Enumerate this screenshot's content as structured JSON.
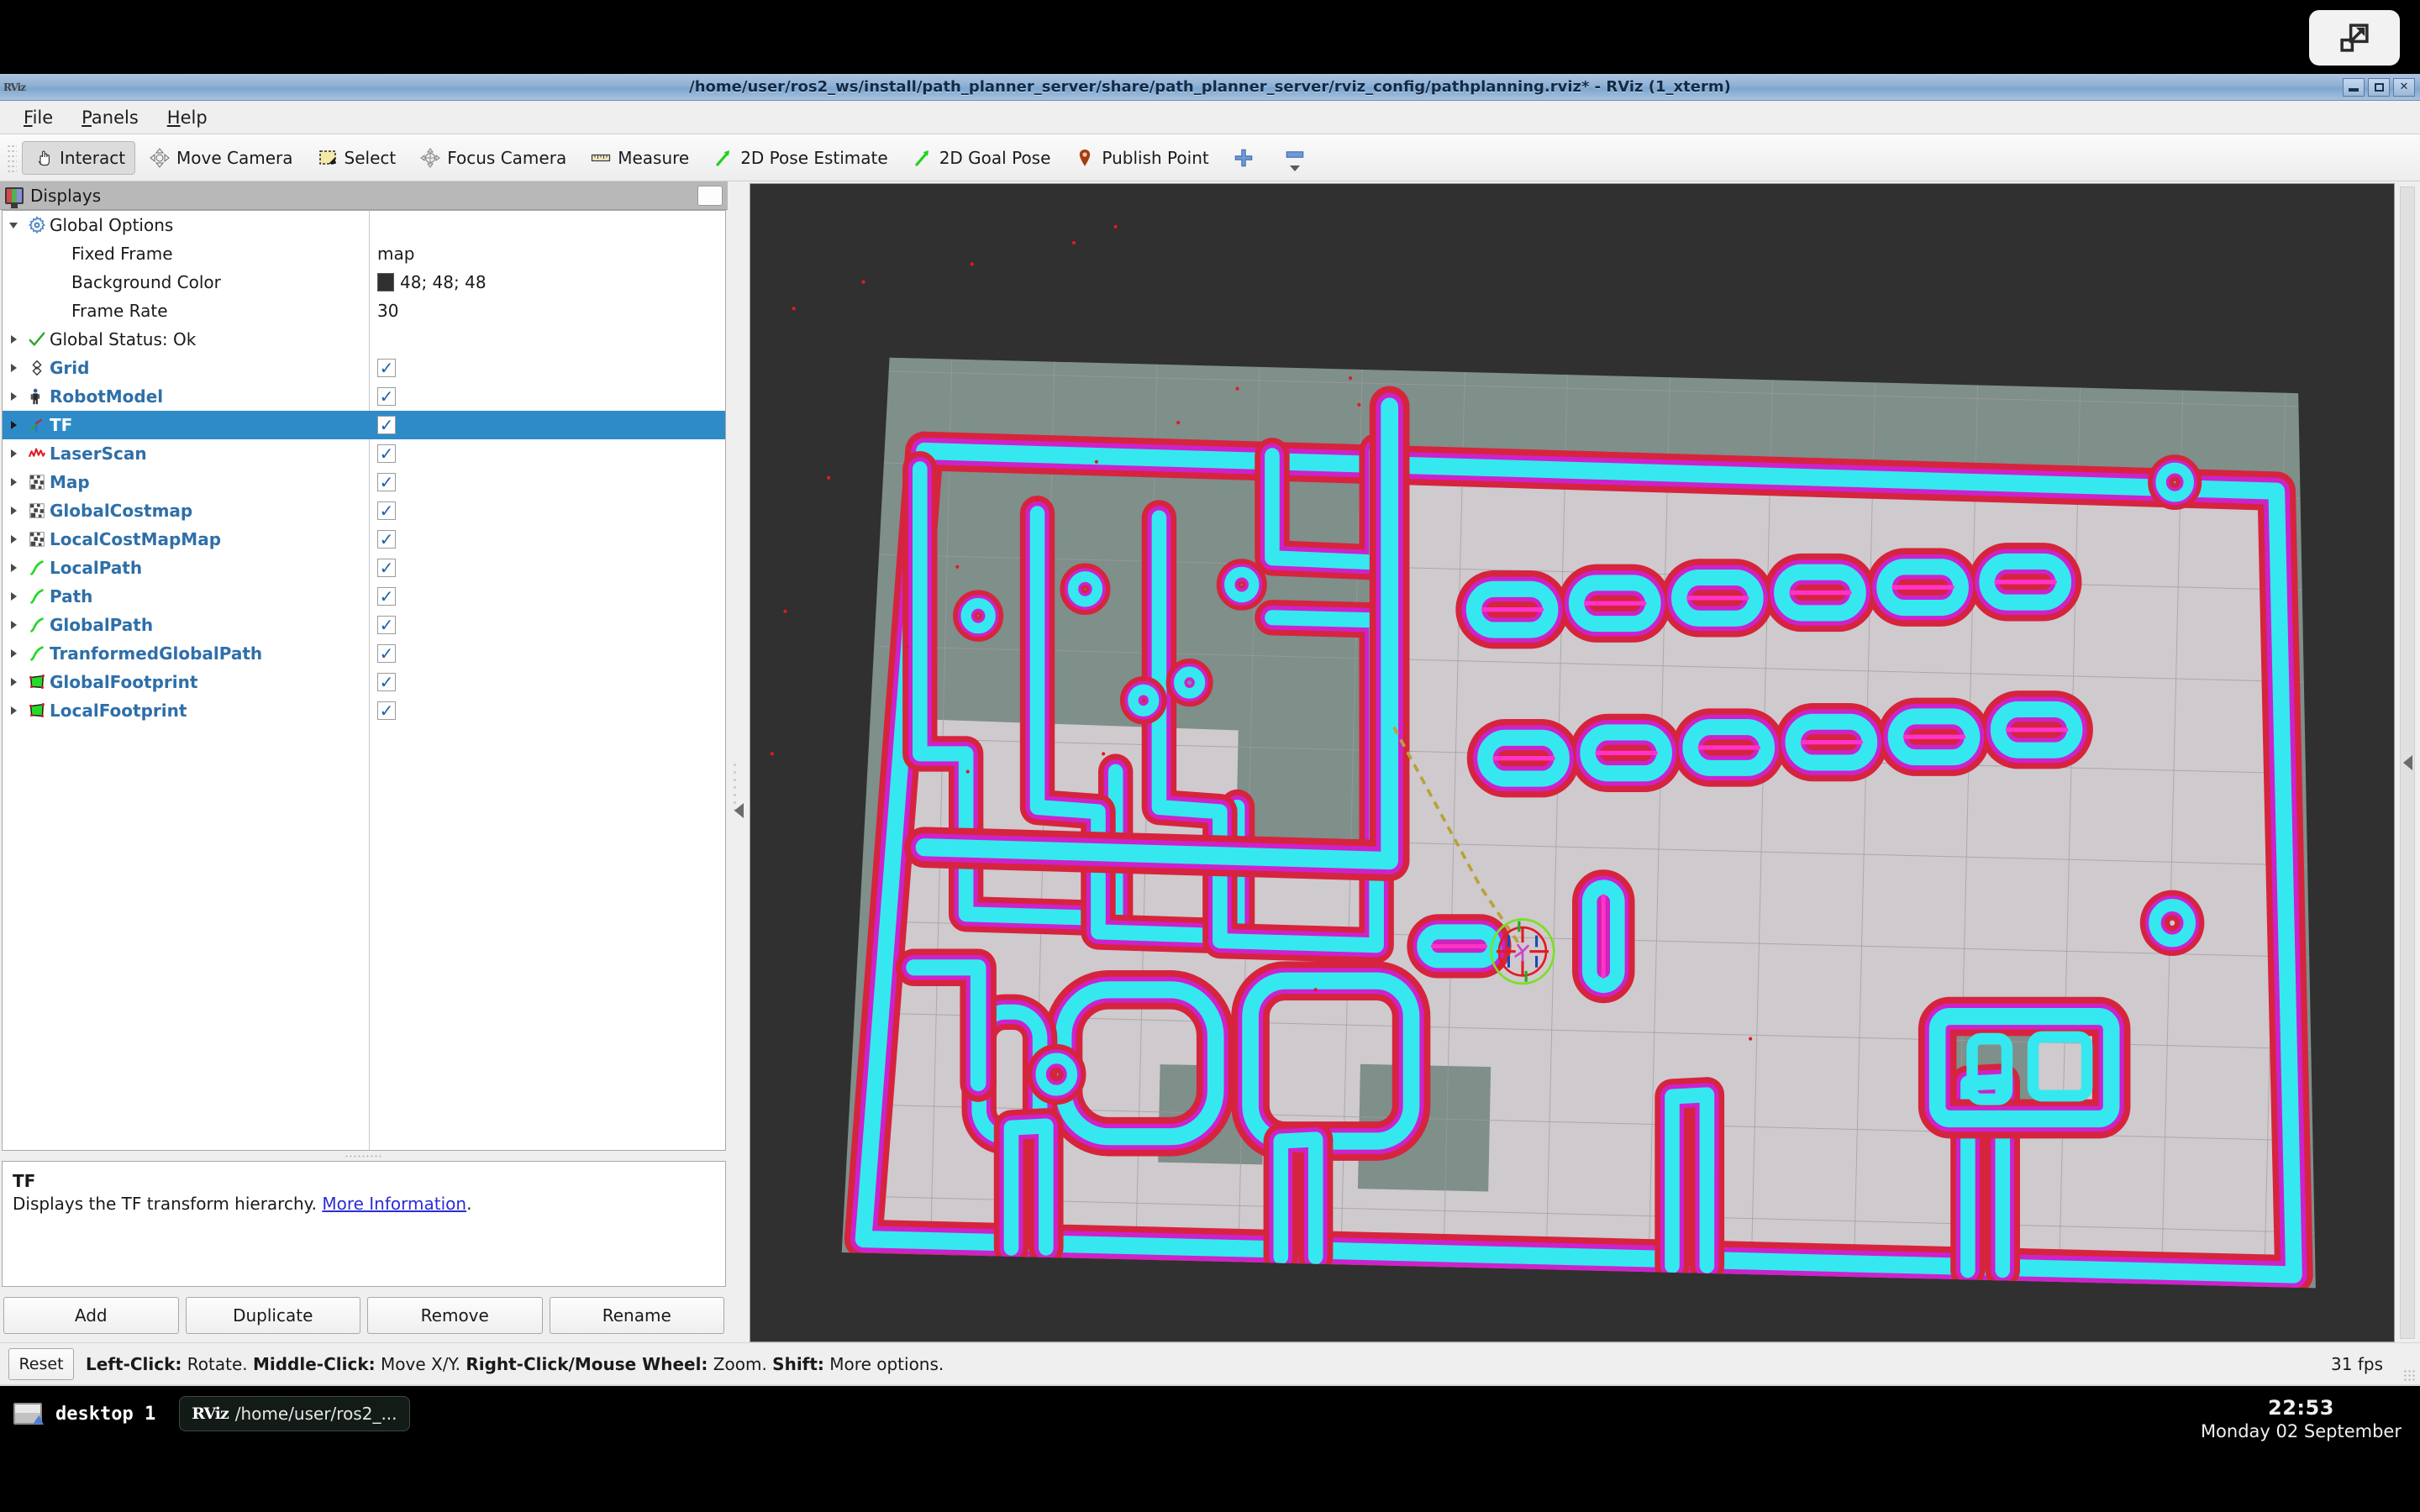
{
  "window": {
    "title": "/home/user/ros2_ws/install/path_planner_server/share/path_planner_server/rviz_config/pathplanning.rviz* - RViz (1_xterm)",
    "app_badge": "RViz",
    "minimize_label": "",
    "maximize_label": "",
    "close_label": "✕"
  },
  "overlay": {
    "expand_icon": "expand-window-icon"
  },
  "menubar": {
    "items": [
      {
        "name": "file",
        "label": "File",
        "mnemonic": "F",
        "rest": "ile"
      },
      {
        "name": "panels",
        "label": "Panels",
        "mnemonic": "P",
        "rest": "anels"
      },
      {
        "name": "help",
        "label": "Help",
        "mnemonic": "H",
        "rest": "elp"
      }
    ]
  },
  "toolbar": {
    "tools": [
      {
        "name": "interact",
        "label": "Interact",
        "icon": "hand-cursor-icon",
        "active": true
      },
      {
        "name": "move-camera",
        "label": "Move Camera",
        "icon": "move-arrows-icon",
        "active": false
      },
      {
        "name": "select",
        "label": "Select",
        "icon": "selection-rect-icon",
        "active": false
      },
      {
        "name": "focus-camera",
        "label": "Focus Camera",
        "icon": "focus-target-icon",
        "active": false
      },
      {
        "name": "measure",
        "label": "Measure",
        "icon": "ruler-icon",
        "active": false
      },
      {
        "name": "2d-pose-estimate",
        "label": "2D Pose Estimate",
        "icon": "green-arrow-icon",
        "active": false
      },
      {
        "name": "2d-goal-pose",
        "label": "2D Goal Pose",
        "icon": "green-arrow-icon",
        "active": false
      },
      {
        "name": "publish-point",
        "label": "Publish Point",
        "icon": "map-pin-icon",
        "active": false
      },
      {
        "name": "add-tool",
        "label": "",
        "icon": "plus-icon",
        "active": false
      },
      {
        "name": "remove-tool",
        "label": "",
        "icon": "minus-icon",
        "active": false
      }
    ]
  },
  "displays_panel": {
    "header_title": "Displays",
    "header_icon": "displays-panel-icon",
    "float_button": "float-panel-button",
    "rows": [
      {
        "name": "global-options",
        "label": "Global Options",
        "icon": "gear-icon",
        "expander": "down",
        "indent": 0,
        "bold": false,
        "value_type": "none",
        "value": ""
      },
      {
        "name": "fixed-frame",
        "label": "Fixed Frame",
        "icon": "none",
        "expander": "none",
        "indent": 1,
        "bold": false,
        "value_type": "text",
        "value": "map"
      },
      {
        "name": "background-color",
        "label": "Background Color",
        "icon": "none",
        "expander": "none",
        "indent": 1,
        "bold": false,
        "value_type": "color",
        "value": "48; 48; 48",
        "swatch": "#303030"
      },
      {
        "name": "frame-rate",
        "label": "Frame Rate",
        "icon": "none",
        "expander": "none",
        "indent": 1,
        "bold": false,
        "value_type": "text",
        "value": "30"
      },
      {
        "name": "global-status",
        "label": "Global Status: Ok",
        "icon": "check-icon",
        "expander": "right",
        "indent": 0,
        "bold": false,
        "value_type": "none",
        "value": ""
      },
      {
        "name": "display-grid",
        "label": "Grid",
        "icon": "grid-icon",
        "expander": "right",
        "indent": 0,
        "bold": true,
        "value_type": "checkbox",
        "value": "✓"
      },
      {
        "name": "display-robotmodel",
        "label": "RobotModel",
        "icon": "robot-icon",
        "expander": "right",
        "indent": 0,
        "bold": true,
        "value_type": "checkbox",
        "value": "✓"
      },
      {
        "name": "display-tf",
        "label": "TF",
        "icon": "axes-icon",
        "expander": "right",
        "indent": 0,
        "bold": true,
        "value_type": "checkbox",
        "value": "✓",
        "selected": true
      },
      {
        "name": "display-laserscan",
        "label": "LaserScan",
        "icon": "laserscan-icon",
        "expander": "right",
        "indent": 0,
        "bold": true,
        "value_type": "checkbox",
        "value": "✓"
      },
      {
        "name": "display-map",
        "label": "Map",
        "icon": "map-icon",
        "expander": "right",
        "indent": 0,
        "bold": true,
        "value_type": "checkbox",
        "value": "✓"
      },
      {
        "name": "display-globalcostmap",
        "label": "GlobalCostmap",
        "icon": "map-icon",
        "expander": "right",
        "indent": 0,
        "bold": true,
        "value_type": "checkbox",
        "value": "✓"
      },
      {
        "name": "display-localcostmapmap",
        "label": "LocalCostMapMap",
        "icon": "map-icon",
        "expander": "right",
        "indent": 0,
        "bold": true,
        "value_type": "checkbox",
        "value": "✓"
      },
      {
        "name": "display-localpath",
        "label": "LocalPath",
        "icon": "path-icon",
        "expander": "right",
        "indent": 0,
        "bold": true,
        "value_type": "checkbox",
        "value": "✓"
      },
      {
        "name": "display-path",
        "label": "Path",
        "icon": "path-icon",
        "expander": "right",
        "indent": 0,
        "bold": true,
        "value_type": "checkbox",
        "value": "✓"
      },
      {
        "name": "display-globalpath",
        "label": "GlobalPath",
        "icon": "path-icon",
        "expander": "right",
        "indent": 0,
        "bold": true,
        "value_type": "checkbox",
        "value": "✓"
      },
      {
        "name": "display-tranformedglobalpath",
        "label": "TranformedGlobalPath",
        "icon": "path-icon",
        "expander": "right",
        "indent": 0,
        "bold": true,
        "value_type": "checkbox",
        "value": "✓"
      },
      {
        "name": "display-globalfootprint",
        "label": "GlobalFootprint",
        "icon": "polygon-icon",
        "expander": "right",
        "indent": 0,
        "bold": true,
        "value_type": "checkbox",
        "value": "✓"
      },
      {
        "name": "display-localfootprint",
        "label": "LocalFootprint",
        "icon": "polygon-icon",
        "expander": "right",
        "indent": 0,
        "bold": true,
        "value_type": "checkbox",
        "value": "✓"
      }
    ],
    "description": {
      "title": "TF",
      "text": "Displays the TF transform hierarchy. ",
      "link": "More Information",
      "suffix": "."
    },
    "buttons": [
      {
        "name": "add-button",
        "label": "Add"
      },
      {
        "name": "duplicate-button",
        "label": "Duplicate"
      },
      {
        "name": "remove-button",
        "label": "Remove"
      },
      {
        "name": "rename-button",
        "label": "Rename"
      }
    ]
  },
  "render_view": {
    "background_color": "#303030",
    "map_free_color": "#cfcacd",
    "map_unknown_color": "#7f8f8a",
    "inflation_cyan": "#35e8ef",
    "inflation_magenta": "#cc22cc",
    "inflation_red": "#d6243e",
    "grid_line_color": "#9e9aa0",
    "robot_marker": "robot-pose-marker",
    "global_path_color": "#b8a23a"
  },
  "statusbar": {
    "reset_label": "Reset",
    "hints": [
      {
        "key": "Left-Click:",
        "text": " Rotate."
      },
      {
        "key": "Middle-Click:",
        "text": " Move X/Y."
      },
      {
        "key": "Right-Click/Mouse Wheel:",
        "text": " Zoom."
      },
      {
        "key": "Shift:",
        "text": " More options."
      }
    ],
    "fps": "31 fps"
  },
  "taskbar": {
    "desktop_label": "desktop 1",
    "desktop_icon": "desktop-switcher-icon",
    "task": {
      "badge": "RViz",
      "label": "/home/user/ros2_..."
    },
    "clock": {
      "time": "22:53",
      "date": "Monday 02 September"
    }
  }
}
